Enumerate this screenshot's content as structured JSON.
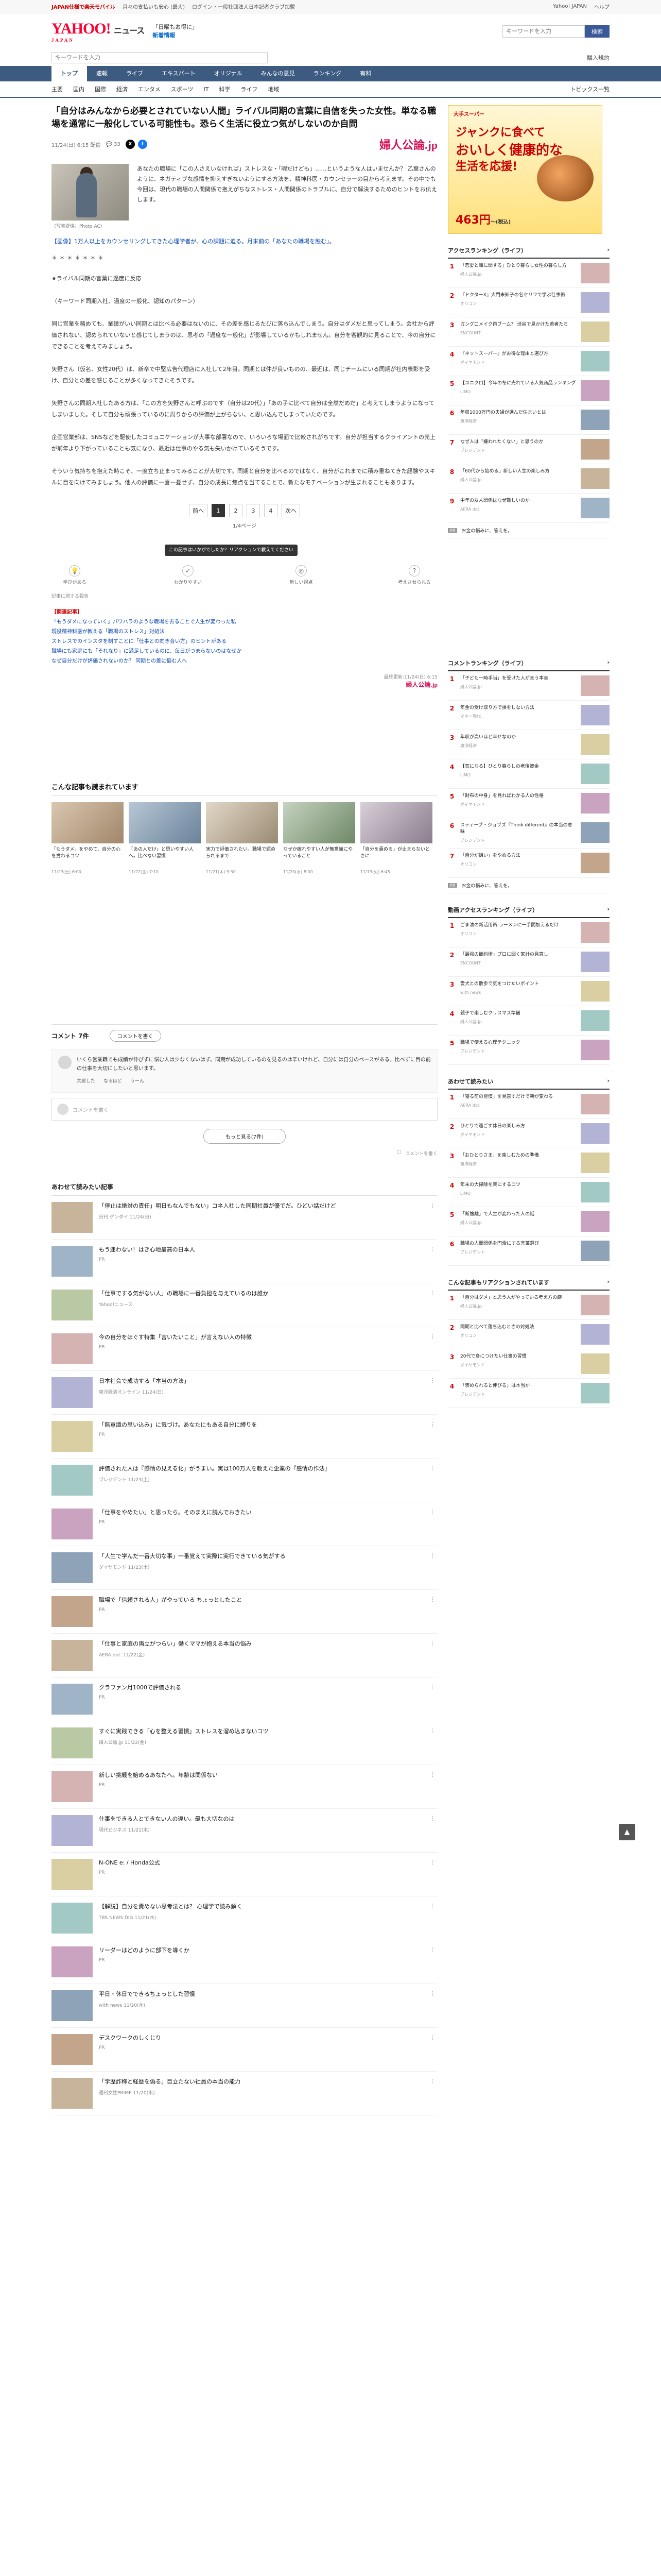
{
  "topline": {
    "notice": "JAPAN仕様で楽天モバイル",
    "promo1": "月々の支払いも安心 (最大)",
    "promo2": "ログイン・一般社団法人日本記者クラブ加盟",
    "yahoo_japan": "Yahoo! JAPAN",
    "help": "ヘルプ"
  },
  "header": {
    "logo": "YAHOO!",
    "logo_sub": "JAPAN",
    "section": "ニュース",
    "promo_a": "「日曜もお得に」",
    "promo_b": "新着情報",
    "search_placeholder": "キーワードを入力",
    "search_button": "検索"
  },
  "subsearch": {
    "placeholder": "キーワードを入力",
    "right": "購入規約"
  },
  "nav": [
    "トップ",
    "速報",
    "ライブ",
    "エキスパート",
    "オリジナル",
    "みんなの意見",
    "ランキング",
    "有料"
  ],
  "subnav": {
    "items": [
      "主要",
      "国内",
      "国際",
      "経済",
      "エンタメ",
      "スポーツ",
      "IT",
      "科学",
      "ライフ",
      "地域"
    ],
    "right": "トピックス一覧"
  },
  "article": {
    "title": "「自分はみんなから必要とされていない人間」ライバル同期の言葉に自信を失った女性。単なる職場を通常に一般化している可能性も。恐らく生活に役立つ気がしないのか自問",
    "date": "11/24(日) 6:15 配信",
    "comment_count": "33",
    "publisher": "婦人公論.jp",
    "caption": "（写真提供：Photo AC）",
    "lead": "あなたの職場に「この人さえいなければ」ストレスな・「暇だけども」……というような人はいませんか？ 乙葉さんのように、ネガティブな感情を抑えすぎないようにする方法を、精神科医・カウンセラーの目から考えます。その中でも今回は、現代の職場の人間関係で抱えがちなストレス・人間関係のトラブルに、自分で解決するためのヒントをお伝えします。",
    "related_title": "【画像】1万人以上をカウンセリングしてきた心理学者が、心の課題に迫る。月末前の「あなたの職場を蝕む」。",
    "paragraphs": [
      "★ライバル同期の言葉に過度に反応",
      "（キーワード同期入社、過度の一般化、認知のパターン）",
      "同じ営業を務めても、業績がいい同期とは比べる必要はないのに、その差を感じるたびに落ち込んでしまう。自分はダメだと思ってしまう。会社から評価されない、認められていないと感じてしまうのは、思考の「過度な一般化」が影響しているかもしれません。自分を客観的に見ることで、今の自分にできることを考えてみましょう。",
      "矢野さん（仮名、女性20代）は、新卒で中堅広告代理店に入社して2年目。同期とは仲が良いものの、最近は、同じチームにいる同期が社内表彰を受け、自分との差を感じることが多くなってきたそうです。",
      "矢野さんの同期入社したある方は、「この方を矢野さんと呼ぶのです（自分は20代）」「あの子に比べて自分は全然だめだ」と考えてしまうようになってしまいました。そして自分も頑張っているのに周りからの評価が上がらない、と思い込んでしまっていたのです。",
      "企画営業部は、SNSなどを駆使したコミュニケーションが大事な部署なので、いろいろな場面で比較されがちです。自分が担当するクライアントの売上が前年より下がっていることも気になり、最近は仕事のやる気も失いかけているそうです。",
      "そういう気持ちを抱えた時こそ、一度立ち止まってみることが大切です。同期と自分を比べるのではなく、自分がこれまでに積み重ねてきた経験やスキルに目を向けてみましょう。他人の評価に一喜一憂せず、自分の成長に焦点を当てることで、新たなモチベーションが生まれることもあります。"
    ],
    "pager": {
      "prev": "前へ",
      "pages": [
        "1",
        "2",
        "3",
        "4"
      ],
      "next": "次へ",
      "count": "1/4ページ"
    },
    "reactions": [
      "学びがある",
      "わかりやすい",
      "新しい視点",
      "考えさせられる"
    ],
    "tooltip": "この記事はいかがでしたか？リアクションで教えてください",
    "source_line": "記事に関する報告",
    "related_links_header": "【関連記事】",
    "related_links": [
      "「もうダメになっていく」パワハラのような職場を去ることで人生が変わった私",
      "現役精神科医が教える「職場のストレス」対処法",
      "ストレスでのインスタを制すことに「仕事との向き合い方」のヒントがある",
      "職場にも家庭にも「それなり」に満足しているのに、毎日がつまらないのはなぜか",
      "なぜ自分だけが評価されないのか？ 同期との差に悩む人へ"
    ],
    "foot_pub": "婦人公論.jp",
    "foot_date": "最終更新:11/24(日) 6:15"
  },
  "recs_title": "こんな記事も読まれています",
  "recs": [
    {
      "t": "「もうダメ」をやめて、自分の心を労わるコツ",
      "d": "11/23(土) 6:00"
    },
    {
      "t": "「あの人だけ」と思いやすい人へ。比べない習慣",
      "d": "11/22(金) 7:10"
    },
    {
      "t": "実力で評価されたい。職場で認められるまで",
      "d": "11/21(木) 9:30"
    },
    {
      "t": "なぜか疲れやすい人が無意識にやっていること",
      "d": "11/20(水) 8:00"
    },
    {
      "t": "「自分を責める」が止まらないときに",
      "d": "11/19(火) 6:45"
    }
  ],
  "comments": {
    "title": "コメント 7件",
    "write_btn": "コメントを書く",
    "sample": "いくら営業職でも成績が伸びずに悩む人は少なくないはず。同期が成功しているのを見るのは辛いけれど、自分には自分のペースがある。比べずに目の前の仕事を大切にしたいと思います。",
    "actions": [
      "共感した",
      "なるほど",
      "うーん"
    ],
    "input_placeholder": "コメントを書く",
    "more": "もっと見る(7件)",
    "note": "コメントを書く"
  },
  "list_title": "あわせて読みたい記事",
  "list": [
    {
      "t": "「停止は絶対の責任」明日もなんでもない」コネ入社した同期社員が優でだ。ひどい話だけど",
      "src": "日刊 ゲンダイ 11/24(日)"
    },
    {
      "t": "もう迷わない！はき心地最高の日本人",
      "src": "PR"
    },
    {
      "t": "「仕事でする気がない人」の職場に一番負担を与えているのは誰か",
      "src": "Yahoo!ニュース"
    },
    {
      "t": "今の自分をほぐす特集「言いたいこと」が言えない人の特徴",
      "src": "PR"
    },
    {
      "t": "日本社会で成功する「本当の方法」",
      "src": "東洋経済オンライン 11/24(日)"
    },
    {
      "t": "「無意識の思い込み」に気づけ。あなたにもある自分に縛りを",
      "src": "PR"
    },
    {
      "t": "評価された人は『感情の見える化』がうまい。実は100万人を教えた企業の『感情の作法』",
      "src": "プレジデント 11/23(土)"
    },
    {
      "t": "「仕事をやめたい」と思ったら。そのまえに読んでおきたい",
      "src": "PR"
    },
    {
      "t": "「人生で学んだ一番大切な事」一番覚えて実際に実行できている気がする",
      "src": "ダイヤモンド 11/23(土)"
    },
    {
      "t": "職場で「信頼される人」がやっている ちょっとしたこと",
      "src": "PR"
    },
    {
      "t": "「仕事と家庭の両立がつらい」働くママが抱える本当の悩み",
      "src": "AERA dot. 11/22(金)"
    },
    {
      "t": "クラファン月1000で評価される",
      "src": "PR"
    },
    {
      "t": "すぐに実践できる「心を整える習慣」ストレスを溜め込まないコツ",
      "src": "婦人公論.jp 11/22(金)"
    },
    {
      "t": "新しい挑戦を始めるあなたへ。年齢は関係ない",
      "src": "PR"
    },
    {
      "t": "仕事をできる人とできない人の違い。最も大切なのは",
      "src": "現代ビジネス 11/21(木)"
    },
    {
      "t": "N-ONE e: / Honda公式",
      "src": "PR"
    },
    {
      "t": "【解説】自分を責めない思考法とは？ 心理学で読み解く",
      "src": "TBS NEWS DIG 11/21(木)"
    },
    {
      "t": "リーダーはどのように部下を導くか",
      "src": "PR"
    },
    {
      "t": "平日・休日でできるちょっとした習慣",
      "src": "with news 11/20(水)"
    },
    {
      "t": "デスクワークのしくじり",
      "src": "PR"
    },
    {
      "t": "「学歴詐称と経歴を偽る」目立たない社員の本当の能力",
      "src": "週刊女性PRIME 11/20(水)"
    }
  ],
  "side": {
    "ad": {
      "brand": "大手スーパー",
      "line1": "ジャンクに食べて",
      "line2": "おいしく健康的な",
      "line3": "生活を応援!",
      "price": "463円",
      "price_unit": "〜(税込)"
    },
    "access_title": "アクセスランキング（ライフ）",
    "access": [
      {
        "t": "「恋愛と職に関する」ひとり暮らし女性の暮らし方",
        "s": "婦人公論.jp"
      },
      {
        "t": "『ドクターX』大門未知子の名セリフで学ぶ仕事術",
        "s": "オリコン"
      },
      {
        "t": "ガングロメイク再ブーム？ 渋谷で見かけた若者たち",
        "s": "ENCOUNT"
      },
      {
        "t": "『ネットスーパー』がお得な理由と選び方",
        "s": "ダイヤモンド"
      },
      {
        "t": "【ユニクロ】今年の冬に売れている人気商品ランキング",
        "s": "LIMO"
      },
      {
        "t": "年収1000万円の夫婦が選んだ住まいとは",
        "s": "東洋経済"
      },
      {
        "t": "なぜ人は「嫌われたくない」と思うのか",
        "s": "プレジデント"
      },
      {
        "t": "「60代から始める」新しい人生の楽しみ方",
        "s": "婦人公論.jp"
      },
      {
        "t": "中年の友人関係はなぜ難しいのか",
        "s": "AERA dot."
      }
    ],
    "pr": "お金の悩みに、答えを。",
    "comment_title": "コメントランキング（ライフ）",
    "comments_rank": [
      {
        "t": "「子ども一時手当」を受けた人が言う本音",
        "s": "婦人公論.jp"
      },
      {
        "t": "年金の受け取り方で損をしない方法",
        "s": "マネー現代"
      },
      {
        "t": "年収が高いほど幸せなのか",
        "s": "東洋経済"
      },
      {
        "t": "【気になる】ひとり暮らしの老後資金",
        "s": "LIMO"
      },
      {
        "t": "「財布の中身」を見ればわかる人の性格",
        "s": "ダイヤモンド"
      },
      {
        "t": "スティーブ・ジョブズ『Think different』の本当の意味",
        "s": "プレジデント"
      },
      {
        "t": "「自分が嫌い」をやめる方法",
        "s": "オリコン"
      }
    ],
    "pr2": "お金の悩みに、答えを。",
    "video_title": "動画アクセスランキング（ライフ）",
    "videos": [
      {
        "t": "ごま油の新活用術 ラーメンに一手間加えるだけ",
        "s": "オリコン"
      },
      {
        "t": "「最強の節約術」プロに聞く家計の見直し",
        "s": "ENCOUNT"
      },
      {
        "t": "愛犬との散歩で気をつけたいポイント",
        "s": "with news"
      },
      {
        "t": "親子で楽しむクリスマス準備",
        "s": "婦人公論.jp"
      },
      {
        "t": "職場で使える心理テクニック",
        "s": "プレジデント"
      }
    ],
    "popular_title": "あわせて読みたい",
    "popular": [
      {
        "t": "「寝る前の習慣」を見直すだけで朝が変わる",
        "s": "AERA dot."
      },
      {
        "t": "ひとりで過ごす休日の楽しみ方",
        "s": "ダイヤモンド"
      },
      {
        "t": "「おひとりさま」を楽しむための準備",
        "s": "東洋経済"
      },
      {
        "t": "年末の大掃除を楽にするコツ",
        "s": "LIMO"
      },
      {
        "t": "「断捨離」で人生が変わった人の話",
        "s": "婦人公論.jp"
      },
      {
        "t": "職場の人間関係を円滑にする言葉選び",
        "s": "プレジデント"
      }
    ],
    "reaction_title": "こんな記事もリアクションされています",
    "reactions_list": [
      {
        "t": "「自分はダメ」と思う人がやっている考え方の癖",
        "s": "婦人公論.jp"
      },
      {
        "t": "同期と比べて落ち込むときの対処法",
        "s": "オリコン"
      },
      {
        "t": "20代で身につけたい仕事の習慣",
        "s": "ダイヤモンド"
      },
      {
        "t": "「褒められると伸びる」は本当か",
        "s": "プレジデント"
      }
    ]
  }
}
